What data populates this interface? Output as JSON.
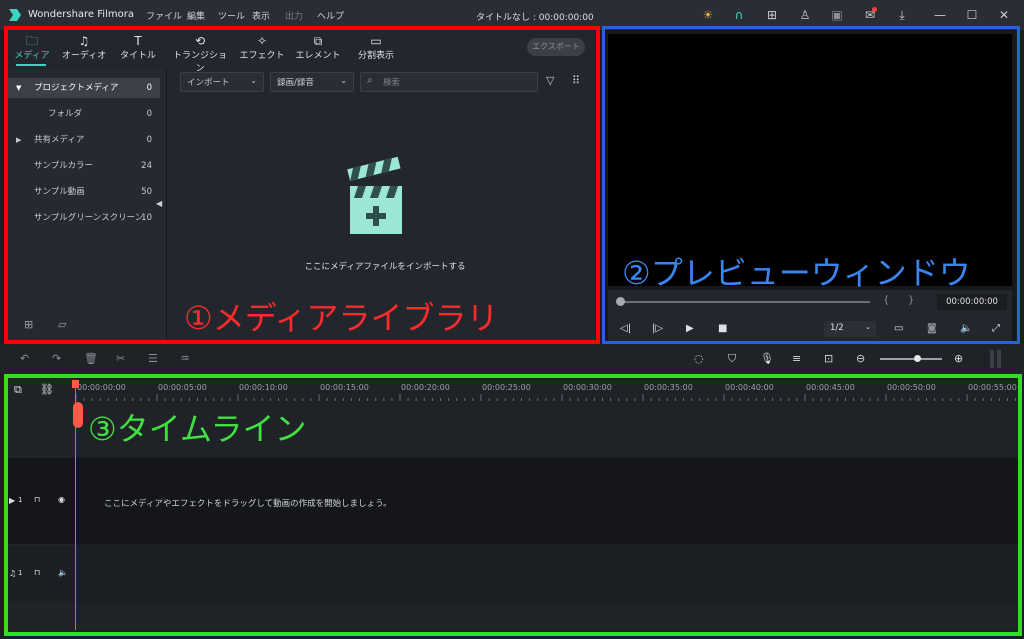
{
  "app": {
    "name": "Wondershare Filmora",
    "title_center": "タイトルなし : 00:00:00:00"
  },
  "menu": {
    "items": [
      "ファイル",
      "編集",
      "ツール",
      "表示",
      "出力",
      "ヘルプ"
    ]
  },
  "media_tabs": [
    {
      "label": "メディア",
      "icon": "folder-icon"
    },
    {
      "label": "オーディオ",
      "icon": "music-icon"
    },
    {
      "label": "タイトル",
      "icon": "text-icon"
    },
    {
      "label": "トランジション",
      "icon": "transition-icon"
    },
    {
      "label": "エフェクト",
      "icon": "effect-icon"
    },
    {
      "label": "エレメント",
      "icon": "element-icon"
    },
    {
      "label": "分割表示",
      "icon": "split-screen-icon"
    }
  ],
  "export_label": "エクスポート",
  "sidebar": {
    "items": [
      {
        "label": "プロジェクトメディア",
        "count": "0"
      },
      {
        "label": "フォルダ",
        "count": "0"
      },
      {
        "label": "共有メディア",
        "count": "0"
      },
      {
        "label": "サンプルカラー",
        "count": "24"
      },
      {
        "label": "サンプル動画",
        "count": "50"
      },
      {
        "label": "サンプルグリーンスクリーン",
        "count": "10"
      }
    ]
  },
  "media": {
    "import_label": "インポート",
    "record_label": "録画/録音",
    "search_placeholder": "検索",
    "import_hint": "ここにメディアファイルをインポートする"
  },
  "preview": {
    "timecode": "00:00:00:00",
    "mark_in": "{",
    "mark_out": "}",
    "ratio": "1/2"
  },
  "timeline": {
    "ticks": [
      "00:00:00:00",
      "00:00:05:00",
      "00:00:10:00",
      "00:00:15:00",
      "00:00:20:00",
      "00:00:25:00",
      "00:00:30:00",
      "00:00:35:00",
      "00:00:40:00",
      "00:00:45:00",
      "00:00:50:00",
      "00:00:55:00"
    ],
    "video_track_num": "1",
    "audio_track_num": "1",
    "drag_hint": "ここにメディアやエフェクトをドラッグして動画の作成を開始しましょう。"
  },
  "annotations": {
    "media_library": "①メディアライブラリ",
    "preview_window": "②プレビューウィンドウ",
    "timeline": "③タイムライン"
  },
  "colors": {
    "accent": "#3ed3c0",
    "playhead": "#ff5a48",
    "annot_media": "#ff0000",
    "annot_preview": "#2563d6",
    "annot_timeline": "#33dd22"
  }
}
